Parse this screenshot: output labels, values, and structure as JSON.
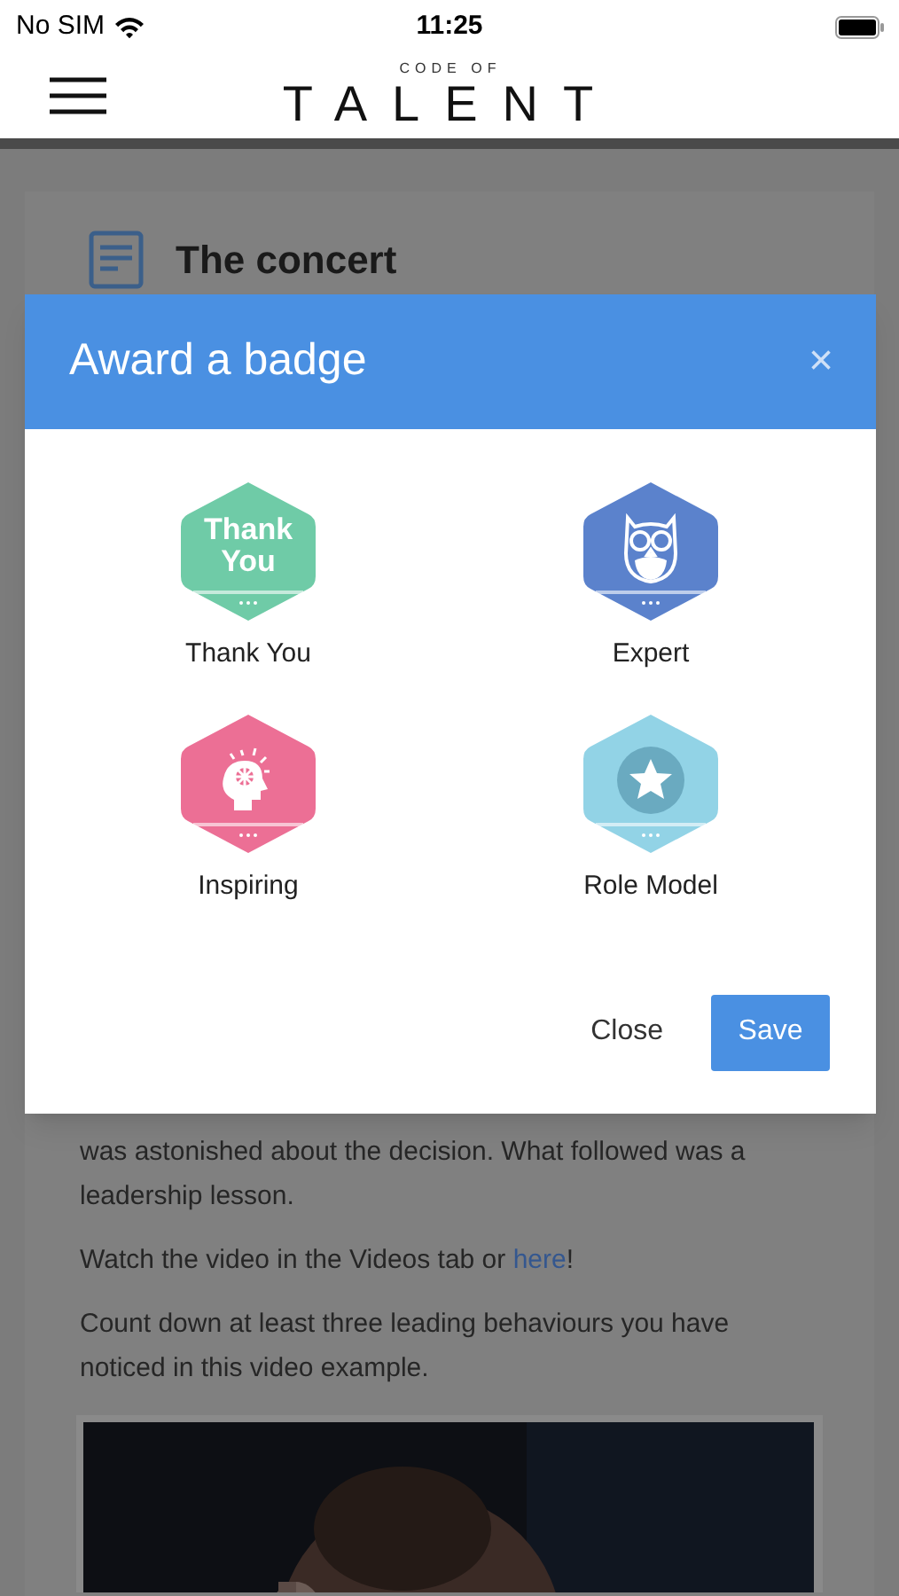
{
  "status_bar": {
    "carrier": "No SIM",
    "time": "11:25"
  },
  "header": {
    "logo_top": "CODE OF",
    "logo_main": "TALENT"
  },
  "article": {
    "title": "The concert",
    "paragraphs": [
      {
        "kind": "plain",
        "text": "was astonished about the decision. What followed was a leadership lesson."
      },
      {
        "kind": "link",
        "before": "Watch the video in the Videos tab or ",
        "link": "here",
        "after": "!"
      },
      {
        "kind": "plain",
        "text": "Count down at least three leading behaviours you have noticed in this video example."
      }
    ]
  },
  "modal": {
    "title": "Award a badge",
    "close_icon": "×",
    "badges": [
      {
        "kind": "text",
        "badge_text": "Thank You",
        "label": "Thank You",
        "color": "#6fcba7"
      },
      {
        "kind": "owl",
        "label": "Expert",
        "color": "#5b82cc"
      },
      {
        "kind": "mind",
        "label": "Inspiring",
        "color": "#ec6f95"
      },
      {
        "kind": "star",
        "label": "Role Model",
        "color": "#92d3e6"
      }
    ],
    "buttons": [
      {
        "kind": "secondary",
        "label": "Close"
      },
      {
        "kind": "primary",
        "label": "Save"
      }
    ]
  }
}
